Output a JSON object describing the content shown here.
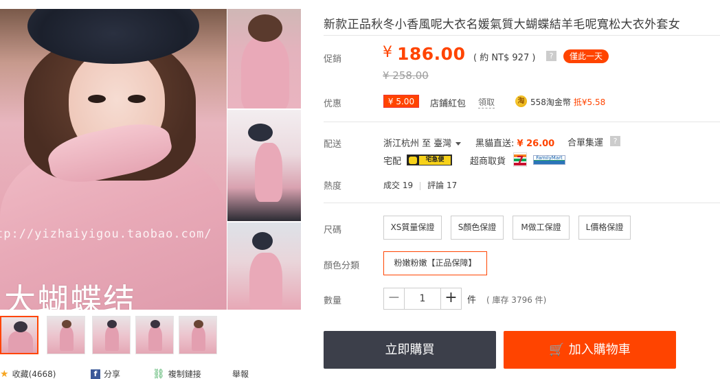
{
  "gallery": {
    "watermark": "tp://yizhaiyigou.taobao.com/",
    "caption": "大蝴蝶结"
  },
  "share_bar": {
    "favorite": "收藏(4668)",
    "share": "分享",
    "copy_link": "複制鏈接",
    "report": "舉報"
  },
  "product": {
    "title": "新款正品秋冬小香風呢大衣名媛氣質大蝴蝶結羊毛呢寬松大衣外套女"
  },
  "labels": {
    "promo": "促銷",
    "discount": "优惠",
    "shipping": "配送",
    "heat": "熱度",
    "size": "尺碼",
    "color": "顏色分類",
    "quantity": "數量"
  },
  "price": {
    "currency": "¥",
    "current": "186.00",
    "ntd": "( 約 NT$ 927 )",
    "help": "?",
    "badge": "僅此一天",
    "original": "¥ 258.00"
  },
  "discount": {
    "coupon": "¥ 5.00",
    "shop_bag": "店鋪紅包",
    "claim": "領取",
    "coin_icon": "淘",
    "coins": "558淘金幣",
    "coins_deduct": "抵¥5.58"
  },
  "shipping": {
    "from": "浙江杭州 至 臺灣",
    "direct_label": "黑貓直送:",
    "direct_price": "¥ 26.00",
    "consolidate": "合單集運",
    "help": "?",
    "home_delivery": "宅配",
    "blackcat_logo": "宅急便",
    "store_pickup": "超商取貨",
    "seven_logo": "7",
    "familymart_logo": "FamilyMart"
  },
  "heat": {
    "sold_label": "成交",
    "sold": "19",
    "reviews_label": "評論",
    "reviews": "17"
  },
  "sizes": [
    "XS質量保證",
    "S顏色保證",
    "M做工保證",
    "L價格保證"
  ],
  "color": {
    "selected": "粉嫩粉嫩【正品保障】"
  },
  "quantity": {
    "minus": "−",
    "value": "1",
    "plus": "+",
    "unit": "件",
    "stock": "( 庫存 3796 件)"
  },
  "actions": {
    "buy_now": "立即購買",
    "cart_icon": "🛒",
    "add_to_cart": "加入購物車"
  },
  "colors": {
    "accent": "#ff4400",
    "buy_button": "#3c3f4a"
  }
}
